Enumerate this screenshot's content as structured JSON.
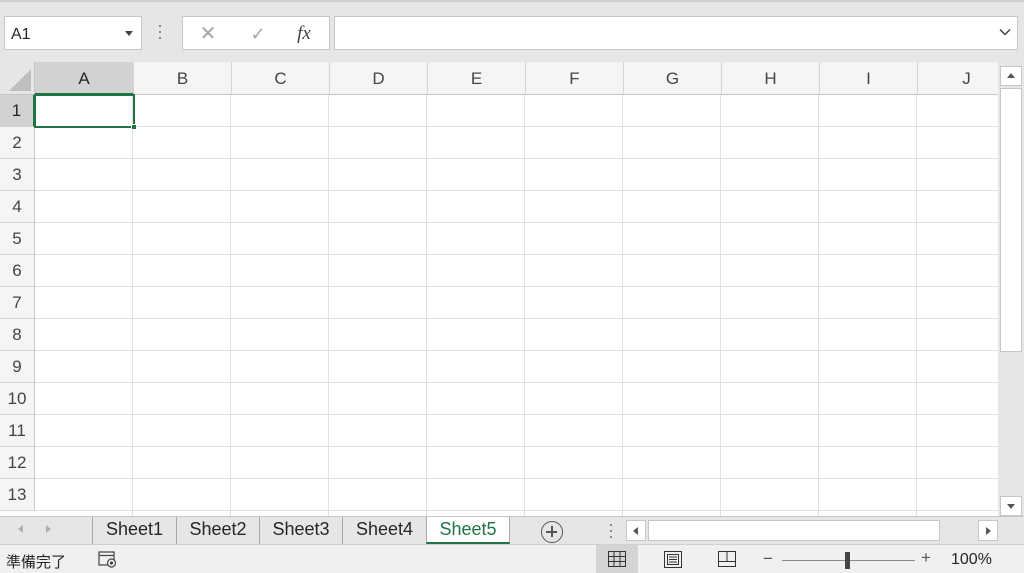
{
  "formula_bar": {
    "name_box": "A1",
    "fx_label": "fx",
    "formula": ""
  },
  "columns": [
    "A",
    "B",
    "C",
    "D",
    "E",
    "F",
    "G",
    "H",
    "I",
    "J"
  ],
  "rows": [
    "1",
    "2",
    "3",
    "4",
    "5",
    "6",
    "7",
    "8",
    "9",
    "10",
    "11",
    "12",
    "13"
  ],
  "active_cell": "A1",
  "sheets": {
    "tabs": [
      "Sheet1",
      "Sheet2",
      "Sheet3",
      "Sheet4",
      "Sheet5"
    ],
    "active": "Sheet5"
  },
  "status": {
    "ready": "準備完了",
    "zoom": "100%",
    "zoom_minus": "−",
    "zoom_plus": "+"
  },
  "icons": {
    "cancel": "close-icon",
    "enter": "checkmark-icon",
    "function": "fx-icon",
    "macro": "macro-record-icon",
    "add_sheet": "plus-circle-icon",
    "view_normal": "grid-view-icon",
    "view_layout": "page-layout-icon",
    "view_pagebreak": "page-break-icon"
  },
  "colors": {
    "accent": "#217346",
    "header_bg": "#f5f5f5",
    "selected_header_bg": "#d2d2d2",
    "gridline": "#e1e1e1"
  }
}
